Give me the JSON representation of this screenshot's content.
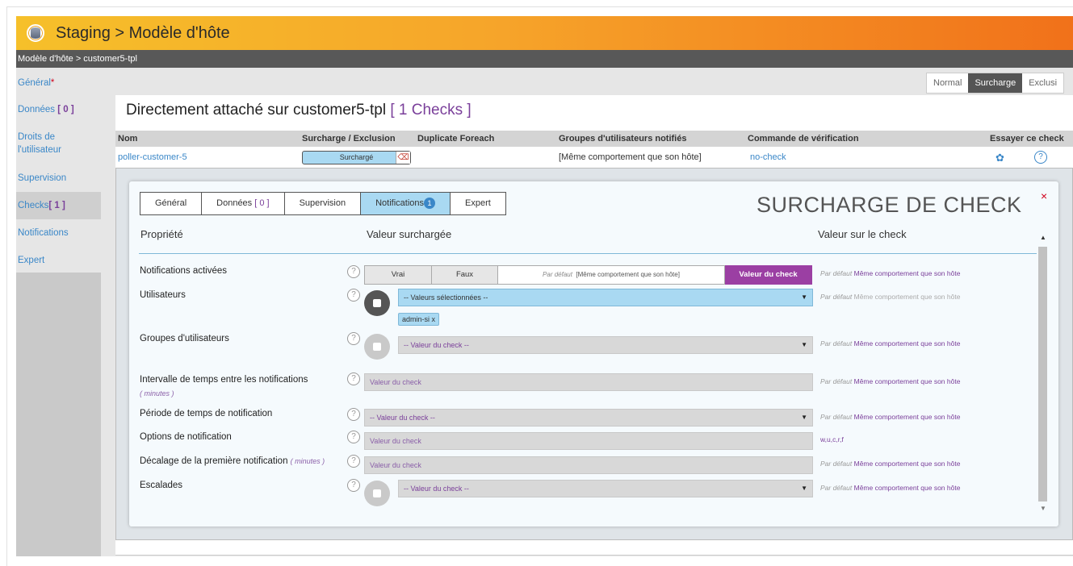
{
  "window": {
    "title": "Staging > Modèle d'hôte"
  },
  "breadcrumb": "Modèle d'hôte > customer5-tpl",
  "sidebar": {
    "items": [
      {
        "label": "Général",
        "required": "*"
      },
      {
        "label": "Données",
        "count": "[ 0 ]"
      },
      {
        "label": "Droits de",
        "label2": "l'utilisateur"
      },
      {
        "label": "Supervision"
      },
      {
        "label": "Checks",
        "count": "[ 1 ]"
      },
      {
        "label": "Notifications"
      },
      {
        "label": "Expert"
      }
    ]
  },
  "view_toggle": {
    "options": [
      "Normal",
      "Surcharge",
      "Exclusi"
    ],
    "selected": "Surcharge"
  },
  "panel": {
    "heading": "Directement attaché sur customer5-tpl",
    "count": "[ 1  Checks ]"
  },
  "table": {
    "columns": [
      "Nom",
      "Surcharge / Exclusion",
      "Duplicate Foreach",
      "Groupes d'utilisateurs notifiés",
      "Commande de vérification",
      "Essayer ce check"
    ],
    "row": {
      "name": "poller-customer-5",
      "override": "Surchargé",
      "duplicate": "",
      "groups": "[Même comportement que son hôte]",
      "command": "no-check"
    }
  },
  "modal": {
    "title": "SURCHARGE DE CHECK",
    "close": "×",
    "tabs": [
      {
        "label": "Général"
      },
      {
        "label": "Données",
        "count": "[ 0 ]"
      },
      {
        "label": "Supervision"
      },
      {
        "label": "Notifications",
        "badge": "1"
      },
      {
        "label": "Expert"
      }
    ],
    "active_tab": "Notifications",
    "col_headers": {
      "property": "Propriété",
      "override": "Valeur surchargée",
      "check": "Valeur sur le check"
    },
    "rows": {
      "notif_enabled": {
        "label": "Notifications activées",
        "options": [
          "Vrai",
          "Faux"
        ],
        "default_prefix": "Par défaut",
        "default_value": "[Même comportement que son hôte]",
        "selected": "Valeur du check",
        "check_prefix": "Par défaut",
        "check_value": "Même comportement que son hôte"
      },
      "users": {
        "label": "Utilisateurs",
        "select": "-- Valeurs sélectionnées --",
        "tag": "admin-si",
        "tag_remove": "x",
        "check_prefix": "Par défaut",
        "check_value": "Même comportement que son hôte"
      },
      "user_groups": {
        "label": "Groupes d'utilisateurs",
        "select": "-- Valeur du check --",
        "check_prefix": "Par défaut",
        "check_value": "Même comportement que son hôte"
      },
      "interval": {
        "label": "Intervalle de temps entre les notifications",
        "unit": "( minutes )",
        "value": "Valeur du check",
        "check_prefix": "Par défaut",
        "check_value": "Même comportement que son hôte"
      },
      "period": {
        "label": "Période de temps de notification",
        "select": "-- Valeur du check --",
        "check_prefix": "Par défaut",
        "check_value": "Même comportement que son hôte"
      },
      "options": {
        "label": "Options de notification",
        "value": "Valeur du check",
        "check_value": "w,u,c,r,f"
      },
      "first_delay": {
        "label": "Décalage de la première notification",
        "unit": "( minutes )",
        "value": "Valeur du check",
        "check_prefix": "Par défaut",
        "check_value": "Même comportement que son hôte"
      },
      "escalations": {
        "label": "Escalades",
        "select": "-- Valeur du check --",
        "check_prefix": "Par défaut",
        "check_value": "Même comportement que son hôte"
      }
    }
  },
  "icons": {
    "help": "?",
    "caret": "▼",
    "gear": "✿",
    "eraser": "eraser-icon"
  },
  "colors": {
    "accent": "#7a3f9a",
    "link": "#3a87c8",
    "selected": "#a9d9f2",
    "title_bar": "#f6a52a"
  }
}
